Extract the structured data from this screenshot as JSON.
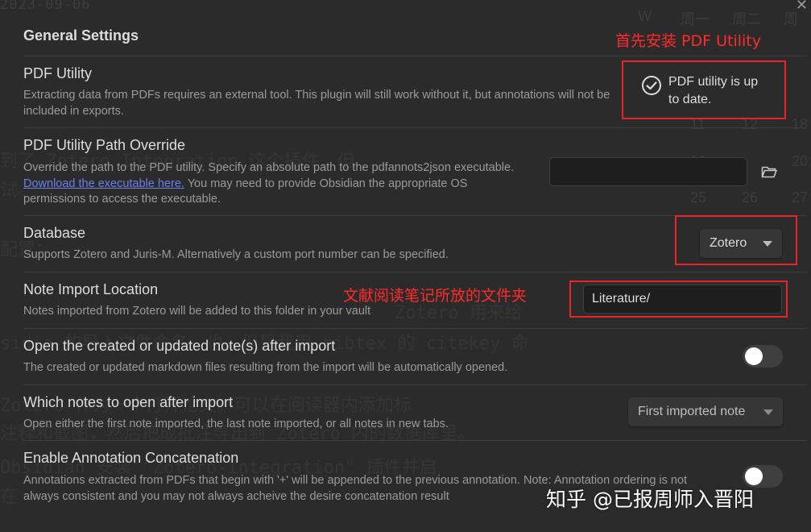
{
  "background": {
    "date": "2023-09-06",
    "calendar_header": [
      "W",
      "周一",
      "周二",
      "周"
    ],
    "calendar_numbers": [
      "11",
      "12",
      "18",
      "19",
      "20",
      "25",
      "26",
      "27"
    ],
    "bg_lines": [
      "到了 Zotero Integration 这个插件，但",
      "试。",
      "配置：",
      "Zotero 用来给",
      "sidia 的导入文件命名。也，但是我用 bibtex 的 citekey 命",
      "Zotero 作为一个打开论文。可以在阅读器内添加标",
      "注释和截图，然后把成批注导出到 Zotero 内的数据库里。",
      "Obsidian 安装 \"Zotero-integration\" 插件并启",
      "在"
    ]
  },
  "modal": {
    "title": "General Settings",
    "annotations": {
      "pdf_utility_note": "首先安装 PDF Utility",
      "note_import_note": "文献阅读笔记所放的文件夹"
    },
    "settings": {
      "pdf_utility": {
        "name": "PDF Utility",
        "desc": "Extracting data from PDFs requires an external tool. This plugin will still work without it, but annotations will not be included in exports.",
        "status_line1": "PDF utility is up",
        "status_line2": "to date."
      },
      "path_override": {
        "name": "PDF Utility Path Override",
        "desc_before": "Override the path to the PDF utility. Specify an absolute path to the pdfannots2json executable.",
        "link": "Download the executable here.",
        "desc_after": "You may need to provide Obsidian the appropriate OS permissions to access the executable.",
        "value": ""
      },
      "database": {
        "name": "Database",
        "desc": "Supports Zotero and Juris-M. Alternatively a custom port number can be specified.",
        "selected": "Zotero"
      },
      "note_import": {
        "name": "Note Import Location",
        "desc": "Notes imported from Zotero will be added to this folder in your vault",
        "value": "Literature/"
      },
      "open_after_import": {
        "name": "Open the created or updated note(s) after import",
        "desc": "The created or updated markdown files resulting from the import will be automatically opened.",
        "enabled": false
      },
      "which_notes": {
        "name": "Which notes to open after import",
        "desc": "Open either the first note imported, the last note imported, or all notes in new tabs.",
        "selected": "First imported note"
      },
      "concatenation": {
        "name": "Enable Annotation Concatenation",
        "desc": "Annotations extracted from PDFs that begin with '+' will be appended to the previous annotation. Note: Annotation ordering is not always consistent and you may not always acheive the desire concatenation result",
        "enabled": false
      }
    }
  },
  "watermark": "知乎 @已报周师入晋阳",
  "colors": {
    "annotation_red": "#e8242b",
    "link": "#6b7fe8",
    "background": "#2b2b2b"
  }
}
